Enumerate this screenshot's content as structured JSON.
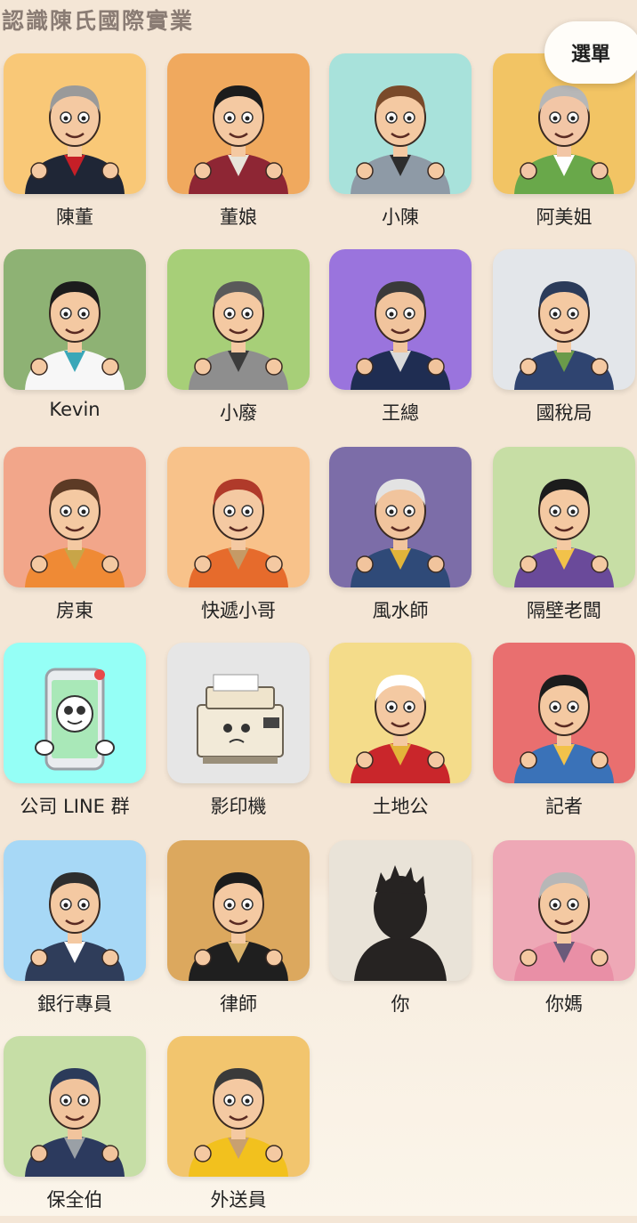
{
  "header": {
    "title": "認識陳氏國際實業",
    "menu_label": "選單"
  },
  "characters": [
    {
      "name": "陳董",
      "bg": "#f9c877",
      "icon": "chairman-icon",
      "skin": "#f4c9a2",
      "hair": "#9a9a9a",
      "outfit": "#1f2636",
      "accent": "#c61f27"
    },
    {
      "name": "董娘",
      "bg": "#f0a95e",
      "icon": "chairman-wife-icon",
      "skin": "#f4c9a2",
      "hair": "#1c1c1c",
      "outfit": "#8e2634",
      "accent": "#e8e4da"
    },
    {
      "name": "小陳",
      "bg": "#a8e2db",
      "icon": "young-chen-icon",
      "skin": "#f4c9a2",
      "hair": "#7a4a2a",
      "outfit": "#8e9aa6",
      "accent": "#2d2d2d"
    },
    {
      "name": "阿美姐",
      "bg": "#f2c464",
      "icon": "auntie-mei-icon",
      "skin": "#f2c6a6",
      "hair": "#b7b7b7",
      "outfit": "#69a84a",
      "accent": "#ffffff"
    },
    {
      "name": "Kevin",
      "bg": "#8eb274",
      "icon": "kevin-icon",
      "skin": "#f4c9a2",
      "hair": "#1c1c1c",
      "outfit": "#f7f7f7",
      "accent": "#3aa7b8"
    },
    {
      "name": "小廢",
      "bg": "#a7cf78",
      "icon": "slacker-icon",
      "skin": "#f4c9a2",
      "hair": "#5a5a5a",
      "outfit": "#8e8e8e",
      "accent": "#3c3c3c"
    },
    {
      "name": "王總",
      "bg": "#9a74dd",
      "icon": "general-manager-wang-icon",
      "skin": "#f1c49d",
      "hair": "#3a3a3a",
      "outfit": "#1f2d52",
      "accent": "#d9d9d9"
    },
    {
      "name": "國稅局",
      "bg": "#e3e6ea",
      "icon": "tax-bureau-icon",
      "skin": "#f4c9a2",
      "hair": "#2b3b5a",
      "outfit": "#2f4470",
      "accent": "#6a9a4a"
    },
    {
      "name": "房東",
      "bg": "#f2a68a",
      "icon": "landlord-icon",
      "skin": "#f4c9a2",
      "hair": "#5c3a25",
      "outfit": "#ef8a35",
      "accent": "#c8a548"
    },
    {
      "name": "快遞小哥",
      "bg": "#f8c28a",
      "icon": "delivery-guy-icon",
      "skin": "#f4c9a2",
      "hair": "#b03a2a",
      "outfit": "#e66b2c",
      "accent": "#c59a66"
    },
    {
      "name": "風水師",
      "bg": "#7c6da8",
      "icon": "fengshui-master-icon",
      "skin": "#f1c49d",
      "hair": "#e3e3e3",
      "outfit": "#2f4a78",
      "accent": "#e1b43a"
    },
    {
      "name": "隔壁老闆",
      "bg": "#c7dea5",
      "icon": "neighbor-boss-icon",
      "skin": "#f4c9a2",
      "hair": "#1c1c1c",
      "outfit": "#6a4a9a",
      "accent": "#f2c24a"
    },
    {
      "name": "公司 LINE 群",
      "bg": "#95fff6",
      "icon": "line-group-phone-icon",
      "skin": "#ffffff",
      "hair": "#d3d3d3",
      "outfit": "#a9e8b8",
      "accent": "#e84a4a"
    },
    {
      "name": "影印機",
      "bg": "#e6e6e6",
      "icon": "printer-icon",
      "skin": "#efe4cc",
      "hair": "#c9bda5",
      "outfit": "#f2ead8",
      "accent": "#9a8f7a"
    },
    {
      "name": "土地公",
      "bg": "#f4dc8a",
      "icon": "earth-god-icon",
      "skin": "#f4c9a2",
      "hair": "#ffffff",
      "outfit": "#c9262b",
      "accent": "#e3b33a"
    },
    {
      "name": "記者",
      "bg": "#e96f6f",
      "icon": "reporter-icon",
      "skin": "#f4c9a2",
      "hair": "#1c1c1c",
      "outfit": "#3a72b8",
      "accent": "#f2c24a"
    },
    {
      "name": "銀行專員",
      "bg": "#a7d8f6",
      "icon": "bank-clerk-icon",
      "skin": "#f4c9a2",
      "hair": "#2e2e2e",
      "outfit": "#2f3d5a",
      "accent": "#ffffff"
    },
    {
      "name": "律師",
      "bg": "#dca85e",
      "icon": "lawyer-icon",
      "skin": "#f4c9a2",
      "hair": "#1c1c1c",
      "outfit": "#1f1f1f",
      "accent": "#d9b26a"
    },
    {
      "name": "你",
      "bg": "#e9e3d8",
      "icon": "you-silhouette-icon",
      "skin": "#262322",
      "hair": "#262322",
      "outfit": "#262322",
      "accent": "#262322"
    },
    {
      "name": "你媽",
      "bg": "#eea8b6",
      "icon": "your-mom-icon",
      "skin": "#f4c9a2",
      "hair": "#b7b7b7",
      "outfit": "#e98fa6",
      "accent": "#6a5a7a"
    },
    {
      "name": "保全伯",
      "bg": "#c6dea6",
      "icon": "security-guard-icon",
      "skin": "#f1c49d",
      "hair": "#2b3b5a",
      "outfit": "#2c3a5e",
      "accent": "#9aa0a6"
    },
    {
      "name": "外送員",
      "bg": "#f2c56e",
      "icon": "food-delivery-icon",
      "skin": "#f4c9a2",
      "hair": "#3a3a3a",
      "outfit": "#f2c11e",
      "accent": "#c8a070"
    }
  ]
}
